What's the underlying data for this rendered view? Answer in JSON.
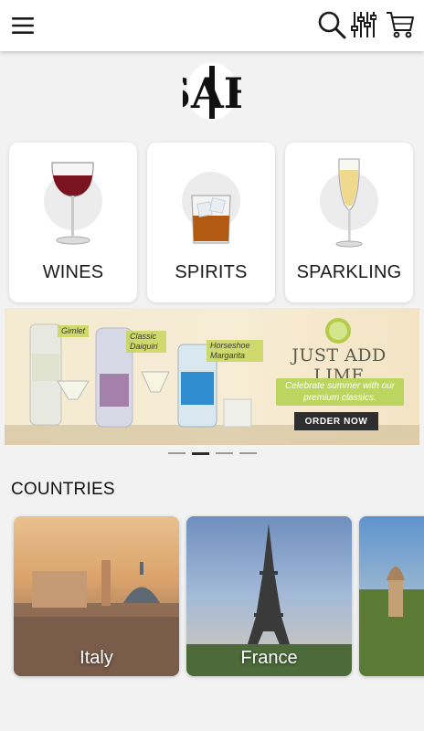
{
  "header": {
    "menu_icon": "hamburger-menu-icon",
    "search_icon": "search-icon",
    "filter_icon": "filter-sliders-icon",
    "cart_icon": "shopping-cart-icon"
  },
  "logo": {
    "text": "SAH"
  },
  "categories": [
    {
      "label": "WINES",
      "icon": "red-wine-glass"
    },
    {
      "label": "SPIRITS",
      "icon": "whiskey-tumbler"
    },
    {
      "label": "SPARKLING",
      "icon": "champagne-flute"
    }
  ],
  "banner": {
    "title": "JUST ADD LIME",
    "subtitle": "Celebrate summer with our premium classics.",
    "cta": "ORDER NOW",
    "tags": [
      "Gimlet",
      "Classic Daiquiri",
      "Horseshoe Margarita"
    ],
    "colors": {
      "lime": "#bcd55e",
      "cream": "#f4e9d1"
    }
  },
  "carousel": {
    "total": 4,
    "active_index": 1
  },
  "countries": {
    "title": "COUNTRIES",
    "items": [
      {
        "label": "Italy"
      },
      {
        "label": "France"
      }
    ]
  }
}
